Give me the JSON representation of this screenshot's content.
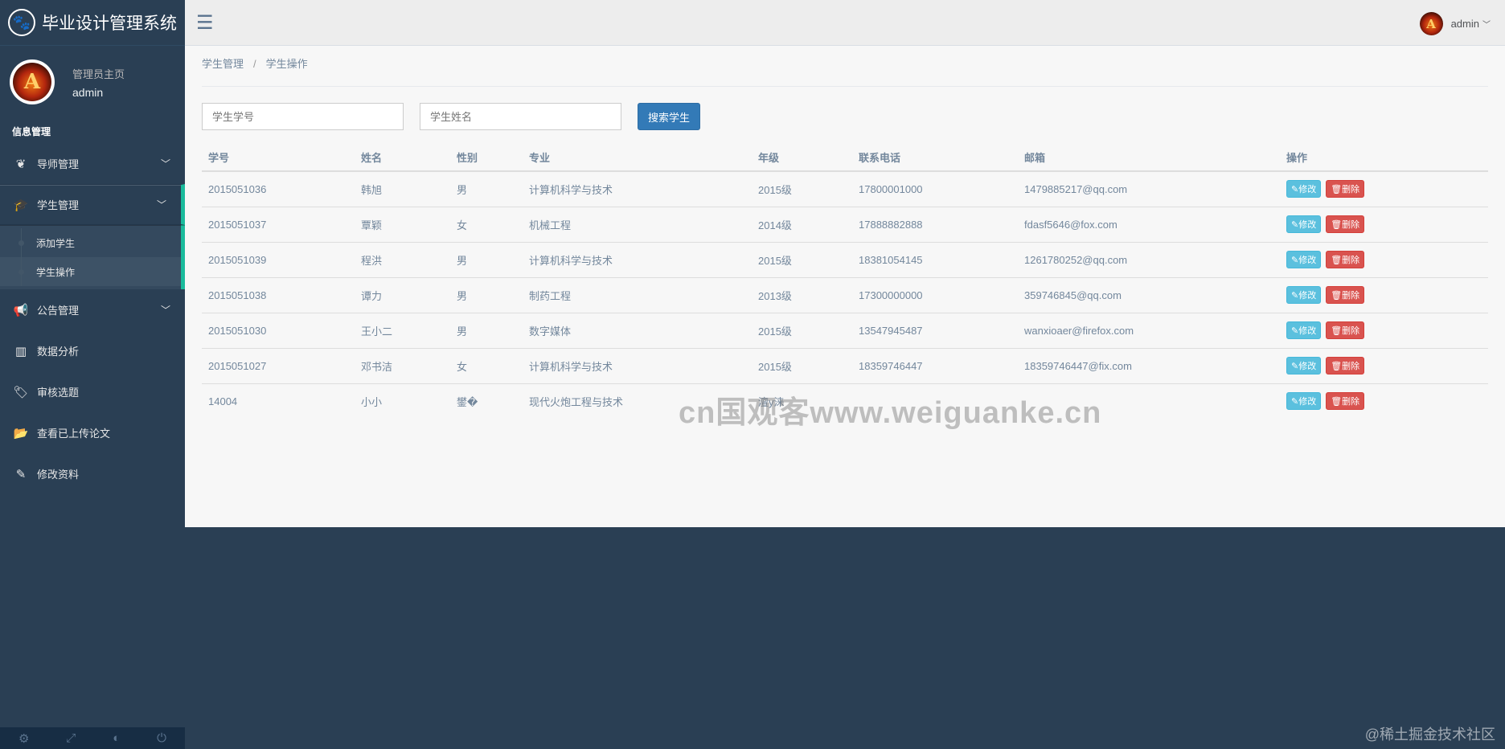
{
  "brand": {
    "icon": "paw-icon",
    "title": "毕业设计管理系统"
  },
  "profile": {
    "welcome": "管理员主页",
    "name": "admin"
  },
  "sidebar": {
    "section_title": "信息管理",
    "items": [
      {
        "label": "导师管理",
        "icon": "leaf-icon"
      },
      {
        "label": "学生管理",
        "icon": "graduation-cap-icon"
      },
      {
        "label": "公告管理",
        "icon": "bullhorn-icon"
      },
      {
        "label": "数据分析",
        "icon": "bar-chart-icon"
      },
      {
        "label": "审核选题",
        "icon": "tags-icon"
      },
      {
        "label": "查看已上传论文",
        "icon": "folder-open-icon"
      },
      {
        "label": "修改资料",
        "icon": "edit-icon"
      }
    ],
    "sub_items": [
      "添加学生",
      "学生操作"
    ]
  },
  "topbar": {
    "username": "admin"
  },
  "breadcrumb": {
    "parent": "学生管理",
    "separator": "/",
    "current": "学生操作"
  },
  "search": {
    "id_placeholder": "学生学号",
    "name_placeholder": "学生姓名",
    "button_label": "搜索学生"
  },
  "table": {
    "headers": [
      "学号",
      "姓名",
      "性别",
      "专业",
      "年级",
      "联系电话",
      "邮箱",
      "操作"
    ],
    "edit_label": "✎修改",
    "delete_label": "🗑删除",
    "rows": [
      [
        "2015051036",
        "韩旭",
        "男",
        "计算机科学与技术",
        "2015级",
        "17800001000",
        "1479885217@qq.com"
      ],
      [
        "2015051037",
        "覃颖",
        "女",
        "机械工程",
        "2014级",
        "17888882888",
        "fdasf5646@fox.com"
      ],
      [
        "2015051039",
        "程洪",
        "男",
        "计算机科学与技术",
        "2015级",
        "18381054145",
        "1261780252@qq.com"
      ],
      [
        "2015051038",
        "谭力",
        "男",
        "制药工程",
        "2013级",
        "17300000000",
        "359746845@qq.com"
      ],
      [
        "2015051030",
        "王小二",
        "男",
        "数字媒体",
        "2015级",
        "13547945487",
        "wanxioaer@firefox.com"
      ],
      [
        "2015051027",
        "邓书洁",
        "女",
        "计算机科学与技术",
        "2015级",
        "18359746447",
        "18359746447@fix.com"
      ],
      [
        "14004",
        "小小",
        "鐢�",
        "现代火炮工程与技术",
        "澶y涞",
        "",
        ""
      ]
    ]
  },
  "watermark": "cn国观客www.weiguanke.cn",
  "corner_mark": "@稀土掘金技术社区",
  "colors": {
    "sidebar_bg": "#2a3f54",
    "accent": "#1abb9c",
    "primary": "#337ab7",
    "info": "#5bc0de",
    "danger": "#d9534f"
  }
}
